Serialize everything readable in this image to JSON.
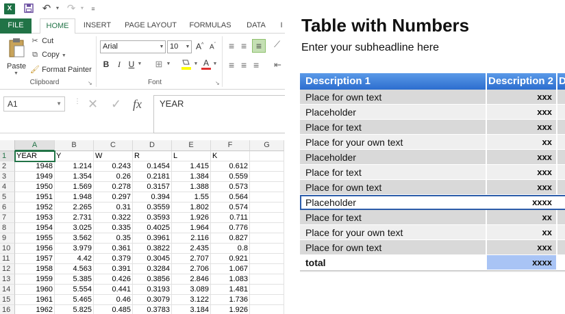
{
  "excel": {
    "title_icons": [
      "excel-logo",
      "save-icon",
      "undo-icon",
      "redo-icon",
      "customize-icon"
    ],
    "tabs": [
      "FILE",
      "HOME",
      "INSERT",
      "PAGE LAYOUT",
      "FORMULAS",
      "DATA",
      "I"
    ],
    "active_tab": "HOME",
    "clipboard": {
      "paste": "Paste",
      "cut": "Cut",
      "copy": "Copy",
      "format_painter": "Format Painter",
      "label": "Clipboard"
    },
    "font": {
      "name": "Arial",
      "size": "10",
      "label": "Font",
      "bold": "B",
      "italic": "I",
      "underline": "U",
      "font_color": "A"
    },
    "name_box": "A1",
    "formula_value": "YEAR",
    "fx": "fx",
    "columns": [
      "A",
      "B",
      "C",
      "D",
      "E",
      "F",
      "G"
    ],
    "rows": [
      "1",
      "2",
      "3",
      "4",
      "5",
      "6",
      "7",
      "8",
      "9",
      "10",
      "11",
      "12",
      "13",
      "14",
      "15",
      "16"
    ],
    "data": [
      [
        "YEAR",
        "Y",
        "W",
        "R",
        "L",
        "K"
      ],
      [
        "1948",
        "1.214",
        "0.243",
        "0.1454",
        "1.415",
        "0.612"
      ],
      [
        "1949",
        "1.354",
        "0.26",
        "0.2181",
        "1.384",
        "0.559"
      ],
      [
        "1950",
        "1.569",
        "0.278",
        "0.3157",
        "1.388",
        "0.573"
      ],
      [
        "1951",
        "1.948",
        "0.297",
        "0.394",
        "1.55",
        "0.564"
      ],
      [
        "1952",
        "2.265",
        "0.31",
        "0.3559",
        "1.802",
        "0.574"
      ],
      [
        "1953",
        "2.731",
        "0.322",
        "0.3593",
        "1.926",
        "0.711"
      ],
      [
        "1954",
        "3.025",
        "0.335",
        "0.4025",
        "1.964",
        "0.776"
      ],
      [
        "1955",
        "3.562",
        "0.35",
        "0.3961",
        "2.116",
        "0.827"
      ],
      [
        "1956",
        "3.979",
        "0.361",
        "0.3822",
        "2.435",
        "0.8"
      ],
      [
        "1957",
        "4.42",
        "0.379",
        "0.3045",
        "2.707",
        "0.921"
      ],
      [
        "1958",
        "4.563",
        "0.391",
        "0.3284",
        "2.706",
        "1.067"
      ],
      [
        "1959",
        "5.385",
        "0.426",
        "0.3856",
        "2.846",
        "1.083"
      ],
      [
        "1960",
        "5.554",
        "0.441",
        "0.3193",
        "3.089",
        "1.481"
      ],
      [
        "1961",
        "5.465",
        "0.46",
        "0.3079",
        "3.122",
        "1.736"
      ],
      [
        "1962",
        "5.825",
        "0.485",
        "0.3783",
        "3.184",
        "1.926"
      ]
    ]
  },
  "slide": {
    "title": "Table with Numbers",
    "subtitle": "Enter your subheadline here",
    "headers": [
      "Description 1",
      "Description 2",
      "D"
    ],
    "rows": [
      {
        "label": "Place for own text",
        "value": "xxx"
      },
      {
        "label": "Placeholder",
        "value": "xxx"
      },
      {
        "label": "Place for text",
        "value": "xxx"
      },
      {
        "label": "Place for your own text",
        "value": "xx"
      },
      {
        "label": "Placeholder",
        "value": "xxx"
      },
      {
        "label": "Place for text",
        "value": "xxx"
      },
      {
        "label": "Place for own text",
        "value": "xxx"
      },
      {
        "label": "Placeholder",
        "value": "xxxx"
      },
      {
        "label": "Place for text",
        "value": "xx"
      },
      {
        "label": "Place for your own text",
        "value": "xx"
      },
      {
        "label": "Place for own text",
        "value": "xxx"
      }
    ],
    "total": {
      "label": "total",
      "value": "xxxx"
    },
    "colors": {
      "header": "#3a7de0",
      "highlight_border": "#2a5ba8",
      "total_value_bg": "#a9c4f5"
    }
  }
}
